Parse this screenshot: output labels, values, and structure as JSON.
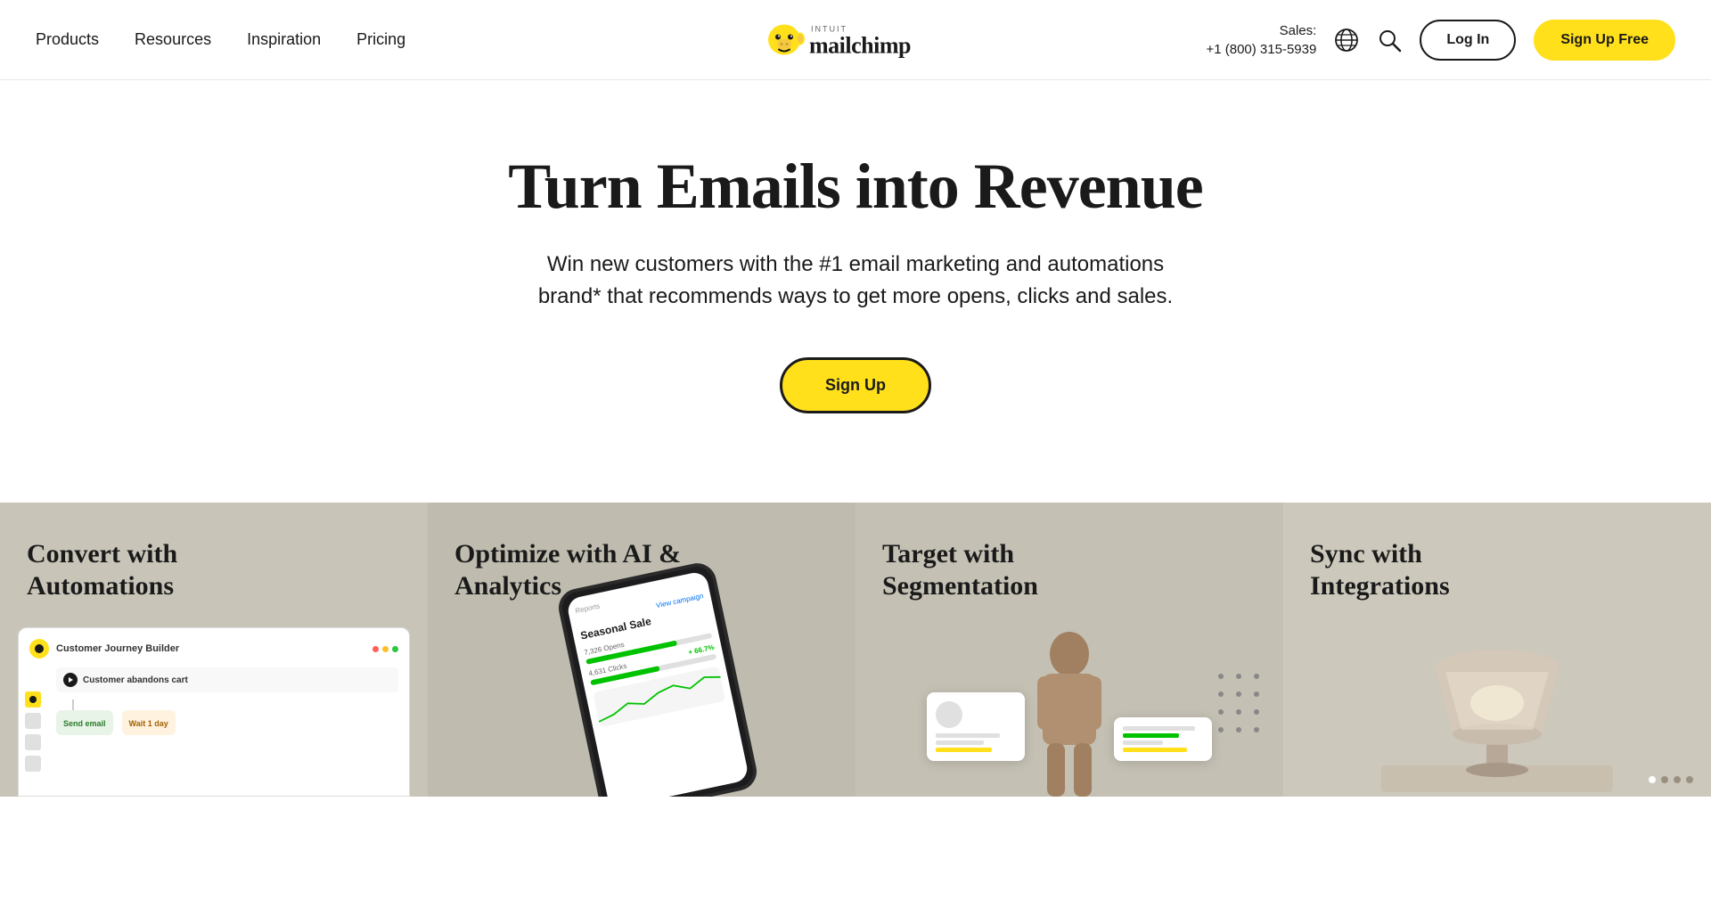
{
  "navbar": {
    "nav_items": [
      {
        "label": "Products",
        "id": "products"
      },
      {
        "label": "Resources",
        "id": "resources"
      },
      {
        "label": "Inspiration",
        "id": "inspiration"
      },
      {
        "label": "Pricing",
        "id": "pricing"
      }
    ],
    "logo_alt": "Intuit Mailchimp",
    "sales_label": "Sales:",
    "sales_phone": "+1 (800) 315-5939",
    "login_label": "Log In",
    "signup_label": "Sign Up Free"
  },
  "hero": {
    "title": "Turn Emails into Revenue",
    "subtitle": "Win new customers with the #1 email marketing and automations brand* that recommends ways to get more opens, clicks and sales.",
    "cta_label": "Sign Up"
  },
  "features": [
    {
      "id": "automations",
      "title": "Convert with Automations",
      "card_text": "Customer Journey Builder",
      "cart_text": "Customer abandons cart"
    },
    {
      "id": "ai-analytics",
      "title": "Optimize with AI & Analytics",
      "campaign_name": "Seasonal Sale",
      "opens": "7,326 Opens",
      "clicks": "4,631 Clicks",
      "badge": "+ 66.7%"
    },
    {
      "id": "segmentation",
      "title": "Target with Segmentation"
    },
    {
      "id": "integrations",
      "title": "Sync with Integrations"
    }
  ],
  "colors": {
    "yellow": "#ffe01b",
    "dark": "#1a1a1a",
    "white": "#ffffff",
    "feature_bg_1": "#c8c4b8",
    "feature_bg_2": "#bfbcaf",
    "feature_bg_3": "#c4c0b4",
    "feature_bg_4": "#ccc8bc"
  }
}
